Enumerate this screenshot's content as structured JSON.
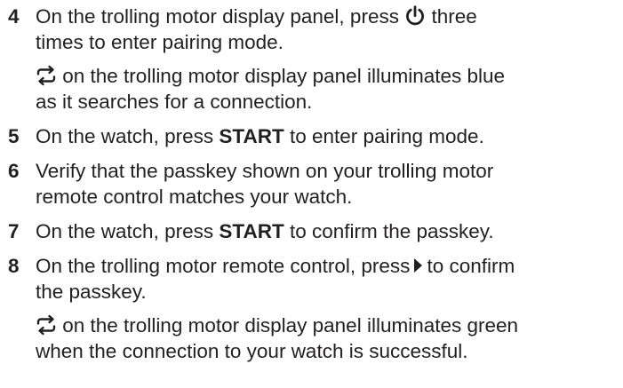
{
  "steps": [
    {
      "number": "4",
      "line1_before": "On the trolling motor display panel, press ",
      "line1_icon": "power-icon",
      "line1_after": " three",
      "line2": "times to enter pairing mode.",
      "note_icon": "pairing-arrows-icon",
      "note_line1_after": " on the trolling motor display panel illuminates blue",
      "note_line2": "as it searches for a connection."
    },
    {
      "number": "5",
      "before": "On the watch, press ",
      "bold": "START",
      "after": " to enter pairing mode."
    },
    {
      "number": "6",
      "line1": "Verify that the passkey shown on your trolling motor",
      "line2": "remote control matches your watch."
    },
    {
      "number": "7",
      "before": "On the watch, press ",
      "bold": "START",
      "after": " to confirm the passkey."
    },
    {
      "number": "8",
      "line1_before": "On the trolling motor remote control, press",
      "line1_icon": "right-arrow-icon",
      "line1_after": "to confirm",
      "line2": "the passkey.",
      "note_icon": "pairing-arrows-icon",
      "note_line1_after": " on the trolling motor display panel illuminates green",
      "note_line2": "when the connection to your watch is successful."
    }
  ],
  "colors": {
    "text": "#231f20",
    "icon": "#231f20"
  }
}
